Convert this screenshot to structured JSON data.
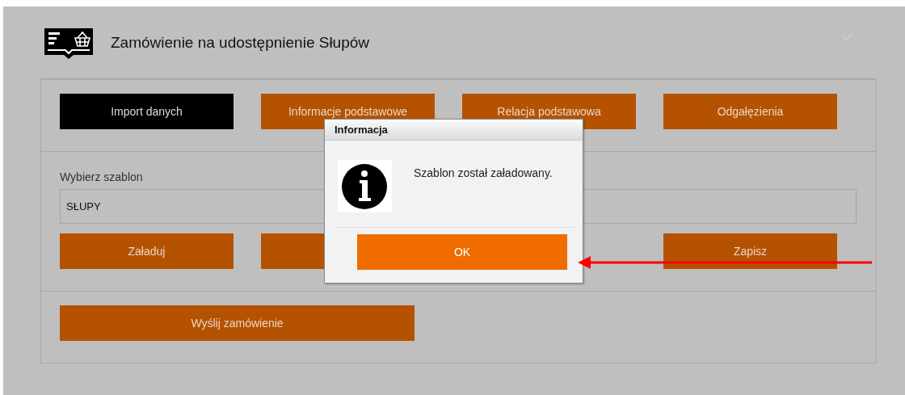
{
  "header": {
    "title": "Zamówienie na udostępnienie Słupów"
  },
  "tabs": [
    {
      "label": "Import danych",
      "selected": true
    },
    {
      "label": "Informacje podstawowe",
      "selected": false
    },
    {
      "label": "Relacja podstawowa",
      "selected": false
    },
    {
      "label": "Odgałęzienia",
      "selected": false
    }
  ],
  "template": {
    "label": "Wybierz szablon",
    "value": "SŁUPY",
    "actions": [
      {
        "label": "Załaduj"
      },
      {
        "kind": "hidden"
      },
      {
        "label": "Zapisz"
      }
    ]
  },
  "submit": {
    "label": "Wyślij zamówienie"
  },
  "dialog": {
    "title": "Informacja",
    "message": "Szablon został załadowany.",
    "button": "OK"
  }
}
